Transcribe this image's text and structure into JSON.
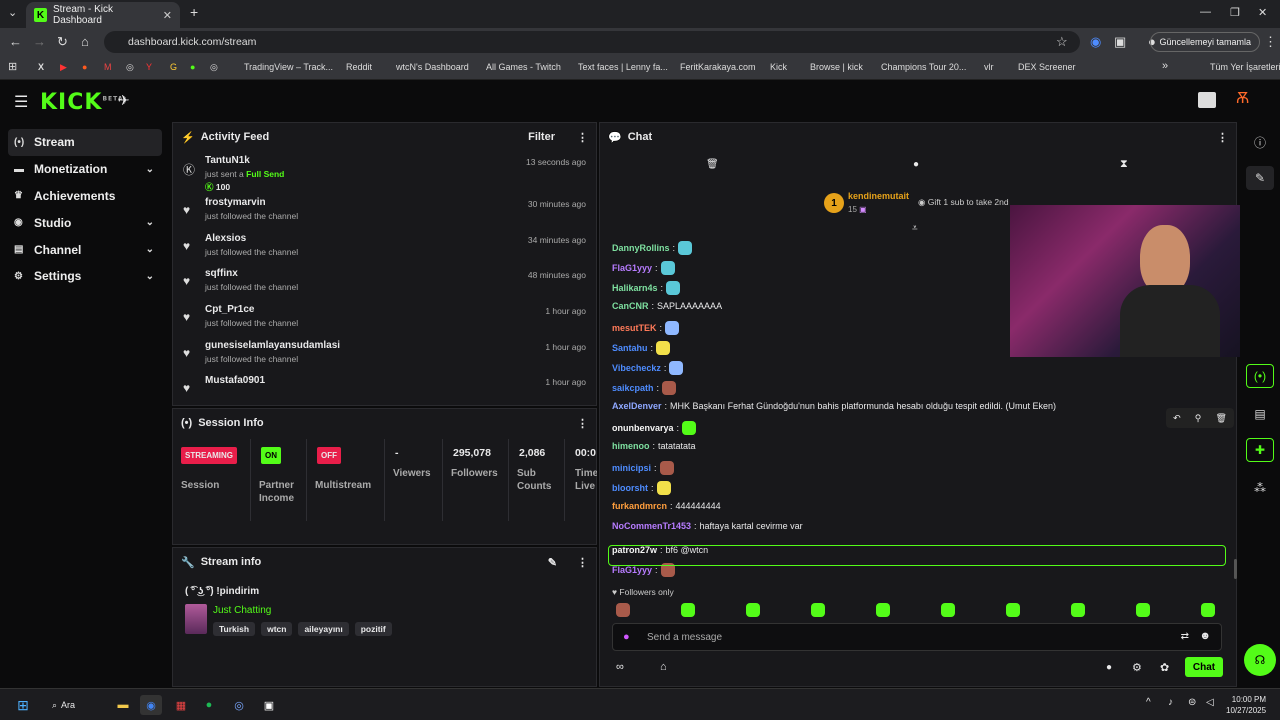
{
  "browser": {
    "tab_title": "Stream - Kick Dashboard",
    "url": "dashboard.kick.com/stream",
    "update_label": "Güncellemeyi tamamla",
    "bookmarks": [
      "TradingView – Track...",
      "Reddit",
      "wtcN's Dashboard",
      "All Games - Twitch",
      "Text faces | Lenny fa...",
      "FeritKarakaya.com",
      "Kick",
      "Browse | kick",
      "Champions Tour 20...",
      "vlr",
      "DEX Screener"
    ],
    "all_bookmarks": "Tüm Yer İşaretleri"
  },
  "brand": {
    "logo": "KICK",
    "beta": "BETA",
    "accent": "#53fc18"
  },
  "sidebar": {
    "items": [
      {
        "label": "Stream"
      },
      {
        "label": "Monetization"
      },
      {
        "label": "Achievements"
      },
      {
        "label": "Studio"
      },
      {
        "label": "Channel"
      },
      {
        "label": "Settings"
      }
    ]
  },
  "activity": {
    "title": "Activity Feed",
    "filter": "Filter",
    "rows": [
      {
        "name": "TantuN1k",
        "sub": "just sent a",
        "sub_extra": "Full Send",
        "amount": "100",
        "time": "13 seconds ago"
      },
      {
        "name": "frostymarvin",
        "sub": "just followed the channel",
        "time": "30 minutes ago"
      },
      {
        "name": "Alexsios",
        "sub": "just followed the channel",
        "time": "34 minutes ago"
      },
      {
        "name": "sqffinx",
        "sub": "just followed the channel",
        "time": "48 minutes ago"
      },
      {
        "name": "Cpt_Pr1ce",
        "sub": "just followed the channel",
        "time": "1 hour ago"
      },
      {
        "name": "gunesiselamlayansudamlasi",
        "sub": "just followed the channel",
        "time": "1 hour ago"
      },
      {
        "name": "Mustafa0901",
        "sub": "",
        "time": "1 hour ago"
      }
    ]
  },
  "session": {
    "title": "Session Info",
    "streaming": "STREAMING",
    "session_label": "Session",
    "on": "ON",
    "partner_label": "Partner Income",
    "off": "OFF",
    "multistream_label": "Multistream",
    "viewers": "-",
    "viewers_label": "Viewers",
    "followers": "295,078",
    "followers_label": "Followers",
    "subs": "2,086",
    "subs_label": "Sub Counts",
    "time": "00:0",
    "time_label": "Time Live"
  },
  "streaminfo": {
    "title": "Stream info",
    "stream_title": "( ͡° ͜ʖ ͡°) !pindirim",
    "category": "Just Chatting",
    "tags": [
      "Turkish",
      "wtcn",
      "aileyayını",
      "pozitif"
    ]
  },
  "chat": {
    "title": "Chat",
    "top_user": "kendinemutait",
    "top_count": "15",
    "gift_text": "Gift 1 sub to take 2nd",
    "rank": "1",
    "messages": [
      {
        "user": "DannyRollins",
        "color": "#7ee0a0",
        "text": "",
        "emote": "#5ac8d8"
      },
      {
        "user": "FlaG1yyy",
        "color": "#b77cff",
        "text": "",
        "emote": "#5ac8d8"
      },
      {
        "user": "Halikarn4s",
        "color": "#7ee0a0",
        "text": "",
        "emote": "#5ac8d8"
      },
      {
        "user": "CanCNR",
        "color": "#7ee0a0",
        "text": "SAPLAAAAAAA",
        "emote": ""
      },
      {
        "user": "mesutTEK",
        "color": "#ff7a59",
        "text": "",
        "emote": "#8fb8ff"
      },
      {
        "user": "Santahu",
        "color": "#4e8cff",
        "text": "",
        "emote": "#f2e04a"
      },
      {
        "user": "Vibecheckz",
        "color": "#4e8cff",
        "text": "",
        "emote": "#8fb8ff"
      },
      {
        "user": "saikcpath",
        "color": "#4e8cff",
        "text": "",
        "emote": "#a85a4a"
      },
      {
        "user": "AxelDenver",
        "color": "#8fa8ff",
        "text": "MHK Başkanı Ferhat Gündoğdu'nun bahis platformunda hesabı olduğu tespit edildi. (Umut Eken)",
        "emote": ""
      },
      {
        "user": "onunbenvarya",
        "color": "#f5f5f5",
        "text": "",
        "emote": "#53fc18"
      },
      {
        "user": "himenoo",
        "color": "#7ee0a0",
        "text": "tatatatata",
        "emote": ""
      },
      {
        "user": "minicipsi",
        "color": "#4e8cff",
        "text": "",
        "emote": "#a85a4a"
      },
      {
        "user": "bloorsht",
        "color": "#4e8cff",
        "text": "",
        "emote": "#f2e04a"
      },
      {
        "user": "furkandmrcn",
        "color": "#ff9e3d",
        "text": "444444444",
        "emote": ""
      },
      {
        "user": "NoCommenTr1453",
        "color": "#b77cff",
        "text": "haftaya kartal cevirme var",
        "emote": ""
      },
      {
        "user": "patron27w",
        "color": "#f5f5f5",
        "text": "bf6 @wtcn",
        "emote": ""
      },
      {
        "user": "FlaG1yyy",
        "color": "#b77cff",
        "text": "",
        "emote": "#a85a4a"
      }
    ],
    "followers_only": "Followers only",
    "placeholder": "Send a message",
    "chat_button": "Chat"
  },
  "taskbar": {
    "search": "Ara",
    "time": "10:00 PM",
    "date": "10/27/2025"
  }
}
